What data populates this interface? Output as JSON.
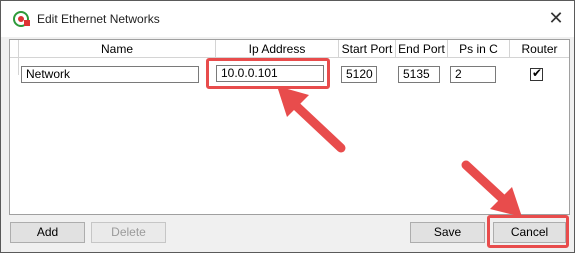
{
  "window": {
    "title": "Edit Ethernet Networks",
    "close_icon": "close-icon"
  },
  "grid": {
    "columns": [
      "Name",
      "Ip Address",
      "Start Port",
      "End Port",
      "Ps in C",
      "Router"
    ],
    "rows": [
      {
        "name": "Network",
        "ip": "10.0.0.101",
        "start_port": "5120",
        "end_port": "5135",
        "ps_in_c": "2",
        "router": true
      }
    ]
  },
  "buttons": {
    "add": "Add",
    "delete": "Delete",
    "save": "Save",
    "cancel": "Cancel"
  },
  "annotations": {
    "color": "#e84c4c"
  }
}
